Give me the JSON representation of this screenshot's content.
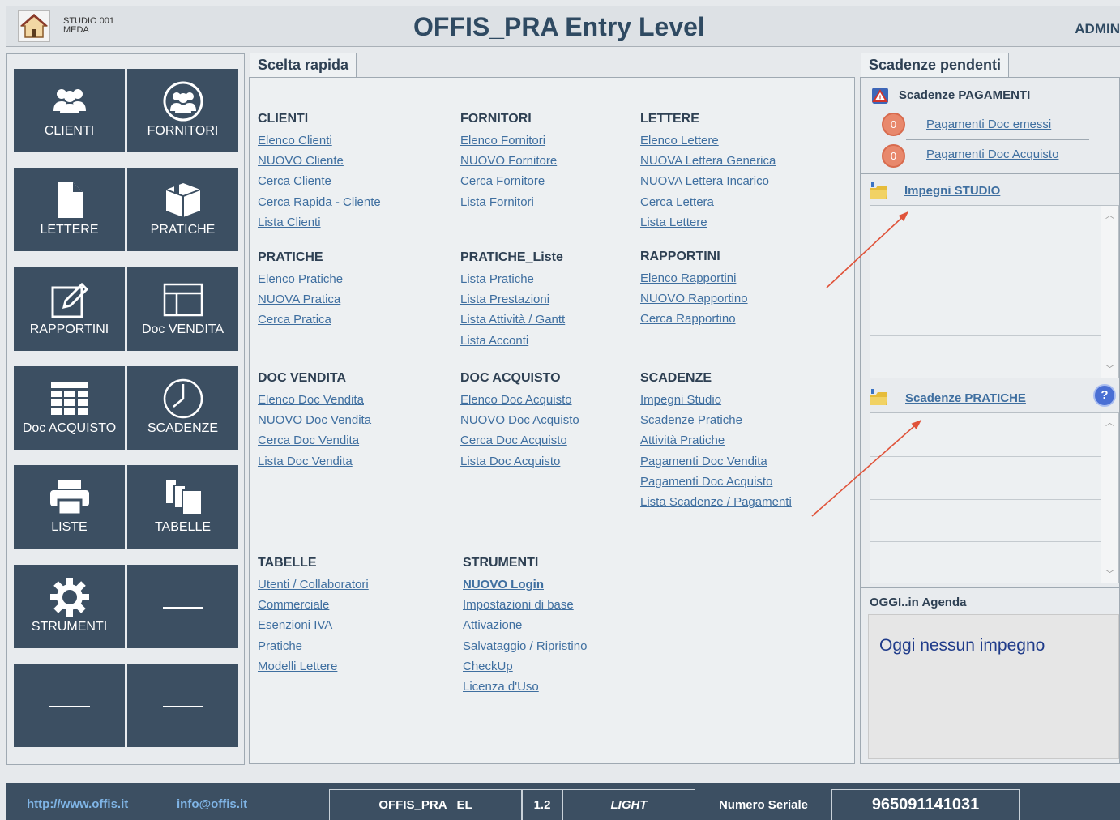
{
  "header": {
    "studio_name": "STUDIO 001\nMEDA",
    "title": "OFFIS_PRA  Entry Level",
    "user": "ADMIN"
  },
  "tiles": [
    {
      "label": "CLIENTI",
      "icon": "users-icon"
    },
    {
      "label": "FORNITORI",
      "icon": "group-circle-icon"
    },
    {
      "label": "LETTERE",
      "icon": "document-icon"
    },
    {
      "label": "PRATICHE",
      "icon": "box-icon"
    },
    {
      "label": "RAPPORTINI",
      "icon": "edit-icon"
    },
    {
      "label": "Doc VENDITA",
      "icon": "layout-icon"
    },
    {
      "label": "Doc ACQUISTO",
      "icon": "table-icon"
    },
    {
      "label": "SCADENZE",
      "icon": "clock-icon"
    },
    {
      "label": "LISTE",
      "icon": "printer-icon"
    },
    {
      "label": "TABELLE",
      "icon": "copy-icon"
    },
    {
      "label": "STRUMENTI",
      "icon": "gear-icon"
    },
    {
      "label": "",
      "icon": "dash-icon"
    },
    {
      "label": "",
      "icon": "dash-icon"
    },
    {
      "label": "",
      "icon": "dash-icon"
    }
  ],
  "scelta_rapida": {
    "tab": "Scelta rapida",
    "sections": [
      {
        "title": "CLIENTI",
        "links": [
          "Elenco Clienti",
          "NUOVO Cliente",
          "Cerca Cliente",
          "Cerca Rapida - Cliente",
          "Lista Clienti"
        ]
      },
      {
        "title": "FORNITORI",
        "links": [
          "Elenco Fornitori",
          "NUOVO Fornitore",
          "Cerca Fornitore",
          "Lista Fornitori"
        ]
      },
      {
        "title": "LETTERE",
        "links": [
          "Elenco Lettere",
          "NUOVA Lettera Generica",
          "NUOVA Lettera Incarico",
          "Cerca Lettera",
          "Lista Lettere"
        ]
      },
      {
        "title": "PRATICHE",
        "links": [
          "Elenco Pratiche",
          "NUOVA Pratica",
          "Cerca Pratica"
        ]
      },
      {
        "title": "PRATICHE_Liste",
        "links": [
          "Lista Pratiche",
          "Lista Prestazioni",
          "Lista Attività / Gantt",
          "Lista Acconti"
        ]
      },
      {
        "title": "RAPPORTINI",
        "links": [
          "Elenco Rapportini",
          "NUOVO Rapportino",
          "Cerca Rapportino"
        ]
      },
      {
        "title": "DOC VENDITA",
        "links": [
          "Elenco Doc Vendita",
          "NUOVO Doc Vendita",
          "Cerca Doc Vendita",
          "Lista Doc Vendita"
        ]
      },
      {
        "title": "DOC ACQUISTO",
        "links": [
          "Elenco Doc Acquisto",
          "NUOVO Doc Acquisto",
          "Cerca Doc Acquisto",
          "Lista Doc Acquisto"
        ]
      },
      {
        "title": "SCADENZE",
        "links": [
          "Impegni Studio",
          "Scadenze Pratiche",
          "Attività Pratiche",
          "Pagamenti Doc Vendita",
          "Pagamenti Doc Acquisto",
          "Lista Scadenze / Pagamenti"
        ]
      },
      {
        "title": "TABELLE",
        "links": [
          "Utenti / Collaboratori",
          "Commerciale",
          "Esenzioni IVA",
          "Pratiche",
          "Modelli Lettere"
        ]
      },
      {
        "title": "STRUMENTI",
        "links": [
          "NUOVO Login",
          "Impostazioni di base",
          "Attivazione",
          "Salvataggio / Ripristino",
          "CheckUp",
          "Licenza d'Uso"
        ]
      }
    ]
  },
  "scadenze": {
    "tab": "Scadenze pendenti",
    "pagamenti_title": "Scadenze PAGAMENTI",
    "pag_emessi_count": "0",
    "pag_emessi": "Pagamenti Doc emessi",
    "pag_acquisto_count": "0",
    "pag_acquisto": "Pagamenti Doc Acquisto",
    "impegni": "Impegni STUDIO",
    "pratiche": "Scadenze PRATICHE",
    "help": "?",
    "agenda_title": "OGGI..in Agenda",
    "agenda_text": "Oggi nessun impegno"
  },
  "footer": {
    "website": "http://www.offis.it",
    "email": "info@offis.it",
    "product": "OFFIS_PRA   EL",
    "version": "1.2",
    "edition": "LIGHT",
    "serial_label": "Numero Seriale",
    "serial": "965091141031"
  }
}
